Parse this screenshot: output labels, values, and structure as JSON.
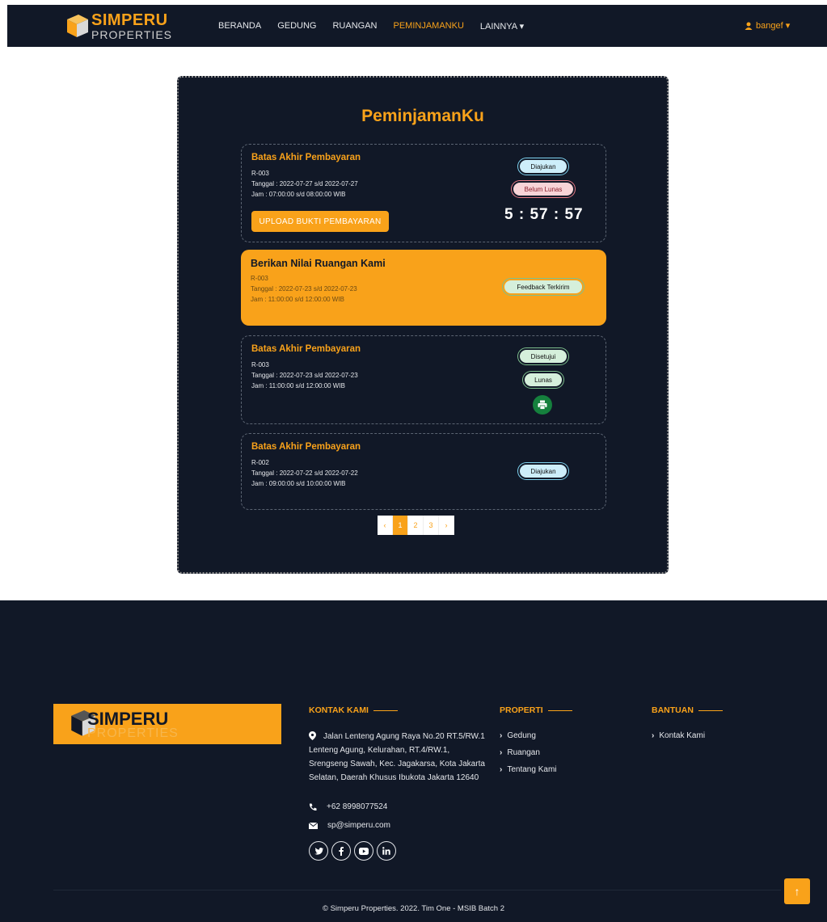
{
  "navbar": {
    "brand_line1": "SIMPERU",
    "brand_line2": "PROPERTIES",
    "links": [
      {
        "label": "BERANDA"
      },
      {
        "label": "GEDUNG"
      },
      {
        "label": "RUANGAN"
      },
      {
        "label": "PEMINJAMANKU"
      },
      {
        "label": "LAINNYA ▾"
      }
    ],
    "user": "bangef ▾"
  },
  "main": {
    "title": "PeminjamanKu",
    "items": [
      {
        "title": "Batas Akhir Pembayaran",
        "room": "R-003",
        "date": "Tanggal : 2022-07-27 s/d 2022-07-27",
        "time": "Jam : 07:00:00 s/d 08:00:00 WIB",
        "badges": [
          "Diajukan",
          "Belum Lunas"
        ],
        "upload_label": "UPLOAD BUKTI PEMBAYARAN",
        "timer": "5 : 57 : 57"
      },
      {
        "title": "Berikan Nilai Ruangan Kami",
        "room": "R-003",
        "date": "Tanggal : 2022-07-23 s/d 2022-07-23",
        "time": "Jam : 11:00:00 s/d 12:00:00 WIB",
        "badges": [
          "Feedback Terkirim"
        ]
      },
      {
        "title": "Batas Akhir Pembayaran",
        "room": "R-003",
        "date": "Tanggal : 2022-07-23 s/d 2022-07-23",
        "time": "Jam : 11:00:00 s/d 12:00:00 WIB",
        "badges": [
          "Disetujui",
          "Lunas"
        ]
      },
      {
        "title": "Batas Akhir Pembayaran",
        "room": "R-002",
        "date": "Tanggal : 2022-07-22 s/d 2022-07-22",
        "time": "Jam : 09:00:00 s/d 10:00:00 WIB",
        "badges": [
          "Diajukan"
        ]
      }
    ],
    "pagination": [
      "‹",
      "1",
      "2",
      "3",
      "›"
    ]
  },
  "footer": {
    "brand_line1": "SIMPERU",
    "brand_line2": "PROPERTIES",
    "kontak_heading": "KONTAK KAMI",
    "address": "Jalan Lenteng Agung Raya No.20 RT.5/RW.1 Lenteng Agung, Kelurahan, RT.4/RW.1, Srengseng Sawah, Kec. Jagakarsa, Kota Jakarta Selatan, Daerah Khusus Ibukota Jakarta 12640",
    "phone": "+62 8998077524",
    "email": "sp@simperu.com",
    "socials": [
      "twitter-icon",
      "facebook-icon",
      "youtube-icon",
      "linkedin-icon"
    ],
    "properti_heading": "PROPERTI",
    "properti_links": [
      "Gedung",
      "Ruangan",
      "Tentang Kami"
    ],
    "bantuan_heading": "BANTUAN",
    "bantuan_links": [
      "Kontak Kami"
    ],
    "copyright": "© Simperu Properties. 2022. Tim One - MSIB Batch 2"
  },
  "colors": {
    "accent": "#f9a21a",
    "dark": "#111827"
  }
}
